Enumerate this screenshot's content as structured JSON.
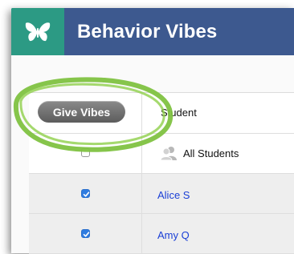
{
  "header": {
    "title": "Behavior Vibes",
    "logo_icon": "butterfly-icon",
    "background_color": "#3d598f",
    "logo_background_color": "#2c9a84"
  },
  "toolbar": {
    "give_vibes_label": "Give Vibes"
  },
  "table": {
    "column_header": "Student",
    "all_students": {
      "label": "All Students",
      "checked": false,
      "icon": "group-icon"
    },
    "rows": [
      {
        "name": "Alice S",
        "checked": true
      },
      {
        "name": "Amy Q",
        "checked": true
      }
    ]
  },
  "annotation": {
    "color": "#7fc241",
    "icon": "green-circle-highlight"
  },
  "colors": {
    "link": "#1a3fd6",
    "checkbox_checked": "#2f7ce0"
  }
}
